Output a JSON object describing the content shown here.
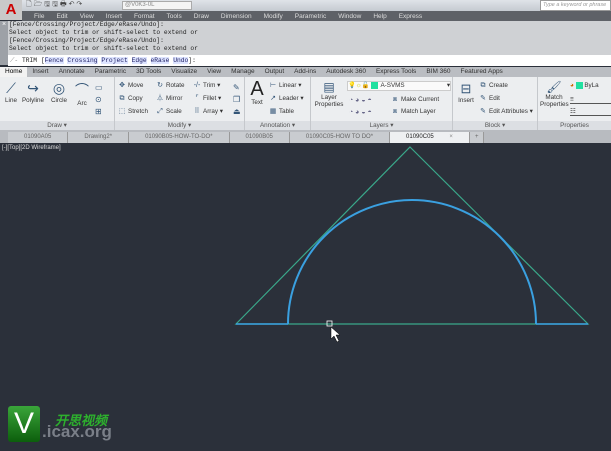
{
  "app": {
    "logo": "A",
    "workspace": "@V0K3-0L",
    "search_placeholder": "Type a keyword or phrase"
  },
  "menu": [
    "File",
    "Edit",
    "View",
    "Insert",
    "Format",
    "Tools",
    "Draw",
    "Dimension",
    "Modify",
    "Parametric",
    "Window",
    "Help",
    "Express"
  ],
  "command": {
    "history": [
      "[Fence/Crossing/Project/Edge/eRase/Undo]:",
      "Select object to trim or shift-select to extend or",
      "[Fence/Crossing/Project/Edge/eRase/Undo]:",
      "Select object to trim or shift-select to extend or"
    ],
    "prompt": "TRIM [",
    "options": [
      "Fence",
      "Crossing",
      "Project",
      "Edge",
      "eRase",
      "Undo"
    ],
    "suffix": "]:"
  },
  "ribbon_tabs": [
    "Home",
    "Insert",
    "Annotate",
    "Parametric",
    "3D Tools",
    "Visualize",
    "View",
    "Manage",
    "Output",
    "Add-ins",
    "Autodesk 360",
    "Express Tools",
    "BIM 360",
    "Featured Apps"
  ],
  "draw": {
    "label": "Draw ▾",
    "line": "Line",
    "polyline": "Polyline",
    "circle": "Circle",
    "arc": "Arc"
  },
  "modify": {
    "label": "Modify ▾",
    "move": "Move",
    "rotate": "Rotate",
    "trim": "Trim",
    "copy": "Copy",
    "mirror": "Mirror",
    "fillet": "Fillet",
    "stretch": "Stretch",
    "scale": "Scale",
    "array": "Array"
  },
  "annotation": {
    "label": "Annotation ▾",
    "text": "Text",
    "linear": "Linear",
    "leader": "Leader",
    "table": "Table"
  },
  "layers": {
    "label": "Layers ▾",
    "layer_properties": "Layer Properties",
    "current_layer": "A-SVMS",
    "make_current": "Make Current",
    "match_layer": "Match Layer"
  },
  "block": {
    "label": "Block ▾",
    "insert": "Insert",
    "create": "Create",
    "edit": "Edit",
    "edit_attributes": "Edit Attributes"
  },
  "properties": {
    "label": "Properties",
    "match": "Match Properties",
    "bylayer": "ByLa"
  },
  "file_tabs": [
    "01090A05",
    "Drawing2*",
    "01090B05-HOW-TO-DO*",
    "01090B05",
    "01090C05-HOW TO DO*",
    "01090C05"
  ],
  "active_file": "01090C05",
  "viewport_label": "[-][Top][2D Wireframe]",
  "watermark": {
    "letter": "V",
    "cn": "开思视频",
    "url": ".icax.org"
  },
  "colors": {
    "triangle": "#3aa88a",
    "arc": "#3aa0e0",
    "canvas": "#2b303a",
    "layer_swatch": "#22e0a0"
  }
}
